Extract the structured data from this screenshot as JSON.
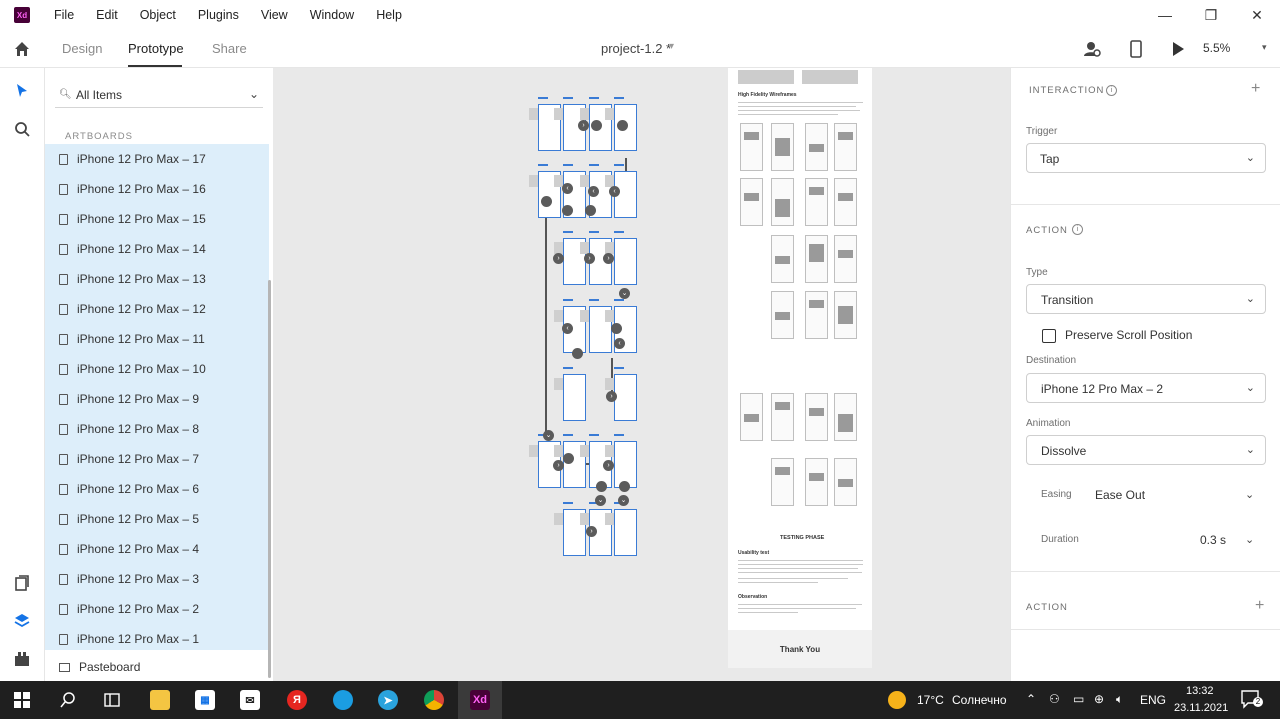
{
  "app": {
    "logo": "Xd"
  },
  "menu": [
    "File",
    "Edit",
    "Object",
    "Plugins",
    "View",
    "Window",
    "Help"
  ],
  "window_controls": [
    "minimize",
    "maximize",
    "close"
  ],
  "toolbar": {
    "tabs": [
      "Design",
      "Prototype",
      "Share"
    ],
    "active_tab": "Prototype",
    "document_title": "project-1.2 *",
    "zoom": "5.5%"
  },
  "layers": {
    "filter": "All Items",
    "section_header": "ARTBOARDS",
    "artboards": [
      "iPhone 12 Pro Max – 17",
      "iPhone 12 Pro Max – 16",
      "iPhone 12 Pro Max – 15",
      "iPhone 12 Pro Max – 14",
      "iPhone 12 Pro Max – 13",
      "iPhone 12 Pro Max – 12",
      "iPhone 12 Pro Max – 11",
      "iPhone 12 Pro Max – 10",
      "iPhone 12 Pro Max – 9",
      "iPhone 12 Pro Max – 8",
      "iPhone 12 Pro Max – 7",
      "iPhone 12 Pro Max – 6",
      "iPhone 12 Pro Max – 5",
      "iPhone 12 Pro Max – 4",
      "iPhone 12 Pro Max – 3",
      "iPhone 12 Pro Max – 2",
      "iPhone 12 Pro Max – 1"
    ],
    "pasteboard": "Pasteboard"
  },
  "canvas_doc": {
    "section_heading": "High Fidelity Wireframes",
    "testing_heading": "TESTING PHASE",
    "usability_heading": "Usability test",
    "observation_heading": "Observation",
    "footer": "Thank You"
  },
  "properties": {
    "interaction_header": "INTERACTION",
    "trigger_label": "Trigger",
    "trigger_value": "Tap",
    "action_header": "ACTION",
    "type_label": "Type",
    "type_value": "Transition",
    "preserve_scroll_label": "Preserve Scroll Position",
    "preserve_scroll_checked": false,
    "destination_label": "Destination",
    "destination_value": "iPhone 12 Pro Max – 2",
    "animation_label": "Animation",
    "animation_value": "Dissolve",
    "easing_label": "Easing",
    "easing_value": "Ease Out",
    "duration_label": "Duration",
    "duration_value": "0.3 s",
    "action2_header": "ACTION"
  },
  "taskbar": {
    "weather_temp": "17°C",
    "weather_desc": "Солнечно",
    "language": "ENG",
    "time": "13:32",
    "date": "23.11.2021",
    "notifications": "2"
  },
  "colors": {
    "selection": "#ddeefa",
    "accent_blue": "#1473e6",
    "artboard_border": "#3a7bd5",
    "xd_brand": "#470137"
  }
}
